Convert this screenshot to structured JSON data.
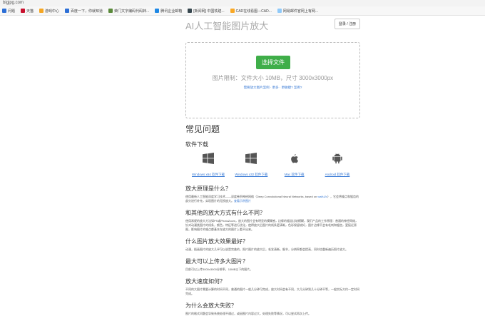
{
  "browser": {
    "url": "bigjpg.com",
    "bookmarks": [
      {
        "label": "问题",
        "color": "#2d6fd6"
      },
      {
        "label": "天猫",
        "color": "#c8102e"
      },
      {
        "label": "游戏中心",
        "color": "#f5a623"
      },
      {
        "label": "百度一下，你就知道",
        "color": "#2d6fd6"
      },
      {
        "label": "荣门文字编码代码转...",
        "color": "#5a8a3a"
      },
      {
        "label": "腾讯企业邮箱",
        "color": "#1e88e5"
      },
      {
        "label": "[新闻网] 中国铁建...",
        "color": "#37474f"
      },
      {
        "label": "CAD在线看图---CAD...",
        "color": "#f9a825"
      },
      {
        "label": "网易邮件官网上有网...",
        "color": "#90caf9"
      }
    ]
  },
  "header": {
    "title": "AI人工智能图片放大",
    "login_label": "登录 / 注册"
  },
  "upload": {
    "select_button": "选择文件",
    "limit_text": "图片限制：文件大小 10MB，尺寸 3000x3000px",
    "help_link": "需要放大图片案例 · 更多 · 更敏捷? 案例?"
  },
  "faq": {
    "heading": "常见问题",
    "software": {
      "heading": "软件下载",
      "items": [
        {
          "label": "Windows x64 软件下载",
          "icon": "windows-icon"
        },
        {
          "label": "Windows x32 软件下载",
          "icon": "windows-icon"
        },
        {
          "label": "Mac 软件下载",
          "icon": "apple-icon"
        },
        {
          "label": "Android 软件下载",
          "icon": "android-icon"
        }
      ]
    },
    "q1": {
      "heading": "放大原理是什么？",
      "text": "使用最新人工智能深度学习技术——深度卷积神经网络（Deep Convolutional Neural Networks, based on ",
      "link1": "waifu2x",
      "text2": "），它会将噪点和锯齿的部分进行补充，实现图片的无损放大。",
      "link2": "查看示例图片"
    },
    "q2": {
      "heading": "和其他的放大方式有什么不同？",
      "text": "使用常规的放大方法如PS或PhotoZoom，放大的图片会有明显的模糊感，边缘的锯齿比较模糊，我们产品的工作原理：普通的神经网络，针对动漫类图片的线条，颜色，特征等进行优化，使得放大后图片的线条更清晰，色彩保留较好，图片边缘不会有毛刺和锯齿，更接近原图，影响图片的噪点都基本在放大的图片上看不出来。"
    },
    "q3": {
      "heading": "什么图片放大效果最好？",
      "text": "动漫，插画图片的放大几乎可以说是完美的，照片图片的放大后，毛发清晰，细节，分辨率都会提高，同时也重新遍历照片放大。"
    },
    "q4": {
      "heading": "最大可以上传多大图片？",
      "text": "目前可以上传3000x3000分辨率，10MB以下的图片。"
    },
    "q5": {
      "heading": "放大速度如何？",
      "text": "不同的大图片需要计算的时间不同，普通的图片一般几分钟可完成，放大时间会有不同，大几分钟到几十分钟不等，一般实际大约一定时间完成。"
    },
    "q6": {
      "heading": "为什么会放大失败？",
      "text": "图片的格式问题会导致系统处理不通过，或因图片内容过大，处理失败等情况，可以尝试再次上传。"
    }
  }
}
